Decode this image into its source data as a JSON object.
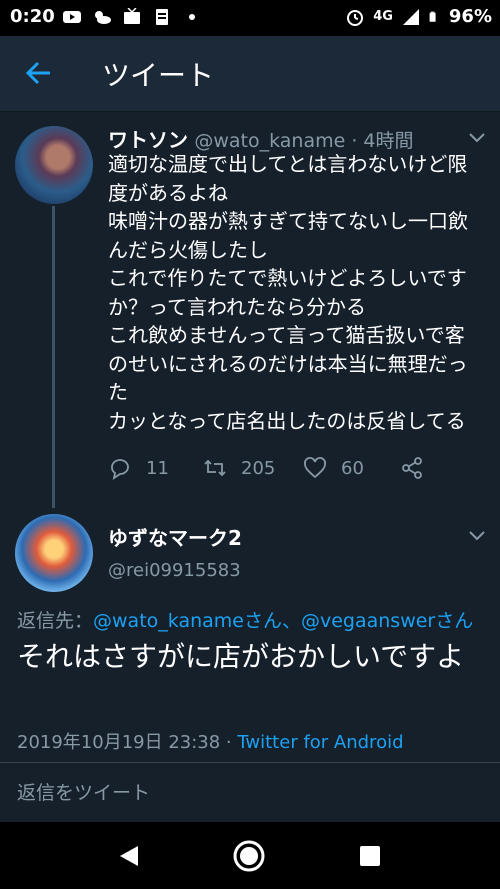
{
  "status_bar": {
    "time": "0:20",
    "network": "4G",
    "battery": "96%",
    "icons": [
      "youtube-icon",
      "weather-icon",
      "tv-icon",
      "clipboard-icon",
      "dot-icon",
      "alarm-icon",
      "signal-icon",
      "battery-icon"
    ]
  },
  "app_bar": {
    "title": "ツイート",
    "back_icon": "arrow-left-icon",
    "accent": "#1da1f2"
  },
  "tweet": {
    "author_name": "ワトソン",
    "handle_time": "@wato_kaname · 4時間",
    "body_lines": [
      "適切な温度で出してとは言わないけど限",
      "度があるよね",
      "味噌汁の器が熱すぎて持てないし一口飲",
      "んだら火傷したし",
      "これで作りたてで熱いけどよろしいです",
      "か？って言われたなら分かる",
      "これ飲めませんって言って猫舌扱いで客",
      "のせいにされるのだけは本当に無理だっ",
      "た",
      "カッとなって店名出したのは反省してる"
    ],
    "replies": "11",
    "retweets": "205",
    "likes": "60"
  },
  "reply": {
    "author_name": "ゆずなマーク2",
    "handle": "@rei09915583",
    "reply_to_prefix": "返信先：",
    "reply_to_mentions": "@wato_kanameさん、@vegaanswerさん",
    "text": "それはさすがに店がおかしいですよ",
    "date": "2019年10月19日 23:38 · ",
    "client": "Twitter for Android"
  },
  "composer": {
    "placeholder": "返信をツイート"
  },
  "colors": {
    "background": "#15202b",
    "secondary_text": "#8899a6",
    "link": "#1da1f2"
  }
}
